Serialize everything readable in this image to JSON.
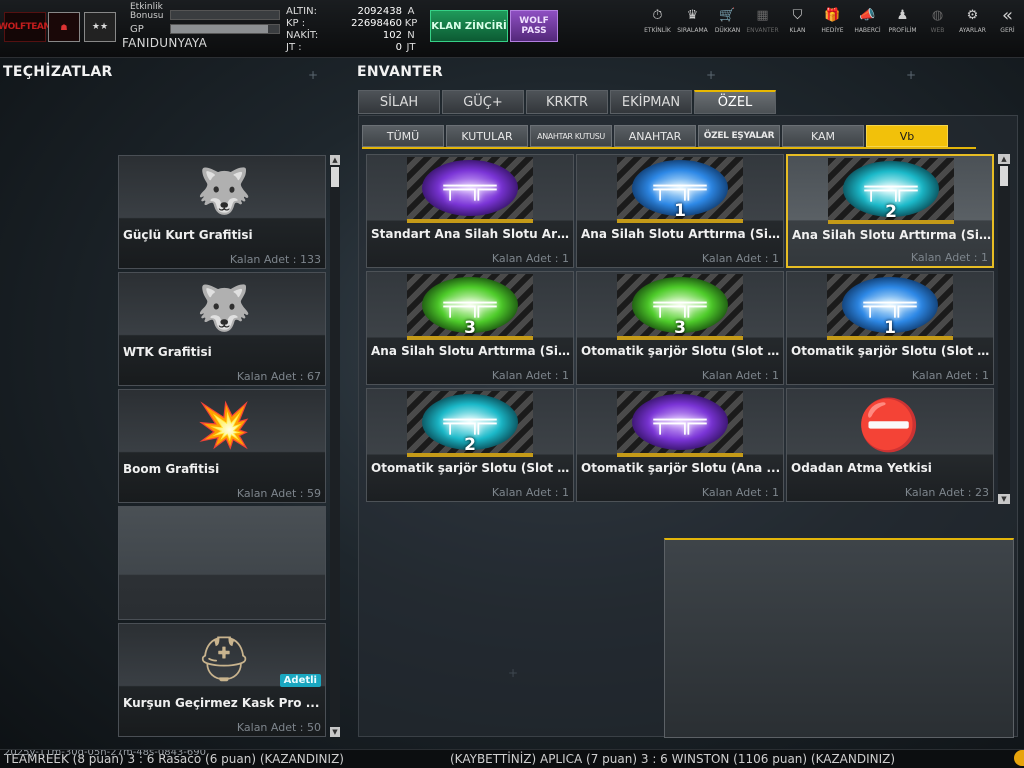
{
  "header": {
    "logo_text": "WOLFTEAM",
    "bonus_label": "Etkinlik Bonusu",
    "gp_label": "GP",
    "bonus_progress": 0,
    "gp_progress": 0.9,
    "username": "FANIDUNYAYA",
    "currencies": [
      {
        "label": "ALTIN:",
        "value": "2092438",
        "unit": "A"
      },
      {
        "label": "KP  :",
        "value": "22698460",
        "unit": "KP"
      },
      {
        "label": "NAKİT:",
        "value": "102",
        "unit": "N"
      },
      {
        "label": "JT  :",
        "value": "0",
        "unit": "JT"
      }
    ],
    "klan_zinciri": "KLAN ZİNCİRİ",
    "wolf_pass": "WOLF PASS"
  },
  "nav": [
    {
      "label": "ETKİNLİK",
      "icon": "stopwatch-icon",
      "glyph": "⏱"
    },
    {
      "label": "SIRALAMA",
      "icon": "wolf-badge-icon",
      "glyph": "♛"
    },
    {
      "label": "DÜKKAN",
      "icon": "cart-icon",
      "glyph": "🛒"
    },
    {
      "label": "ENVANTER",
      "icon": "inventory-icon",
      "glyph": "▦"
    },
    {
      "label": "KLAN",
      "icon": "shield-icon",
      "glyph": "⛉"
    },
    {
      "label": "HEDİYE",
      "icon": "gift-icon",
      "glyph": "🎁"
    },
    {
      "label": "HABERCİ",
      "icon": "megaphone-icon",
      "glyph": "📣"
    },
    {
      "label": "PROFİLİM",
      "icon": "profile-icon",
      "glyph": "♟"
    },
    {
      "label": "WEB",
      "icon": "globe-icon",
      "glyph": "◍"
    },
    {
      "label": "AYARLAR",
      "icon": "gear-icon",
      "glyph": "⚙"
    },
    {
      "label": "GERİ",
      "icon": "back-icon",
      "glyph": "«"
    }
  ],
  "left": {
    "title": "TEÇHİZATLAR",
    "items": [
      {
        "name": "Güçlü Kurt Grafitisi",
        "count": "Kalan Adet : 133",
        "icon": "wolf-graffiti-icon"
      },
      {
        "name": "WTK Grafitisi",
        "count": "Kalan Adet : 67",
        "icon": "wtk-wolf-icon"
      },
      {
        "name": "Boom Grafitisi",
        "count": "Kalan Adet : 59",
        "icon": "boom-graffiti-icon"
      },
      {
        "name": "",
        "count": "",
        "icon": ""
      },
      {
        "name": "Kurşun Geçirmez Kask Pro ...",
        "count": "Kalan Adet : 50",
        "icon": "helmet-icon",
        "badge": "Adetli"
      }
    ]
  },
  "inventory": {
    "title": "ENVANTER",
    "main_tabs": [
      "SİLAH",
      "GÜÇ+",
      "KRKTR",
      "EKİPMAN",
      "ÖZEL"
    ],
    "active_main_tab": 4,
    "sub_tabs": [
      "TÜMÜ",
      "KUTULAR",
      "ANAHTAR KUTUSU",
      "ANAHTAR",
      "ÖZEL EŞYALAR",
      "KAM",
      "Vb"
    ],
    "active_sub_tab": 6,
    "items": [
      {
        "name": "Standart Ana Silah Slotu Artt...",
        "count": "Kalan Adet : 1",
        "color": "purple",
        "slot": ""
      },
      {
        "name": "Ana Silah Slotu Arttırma (Sil...",
        "count": "Kalan Adet : 1",
        "color": "blue",
        "slot": "1"
      },
      {
        "name": "Ana Silah Slotu Arttırma (Si...",
        "count": "Kalan Adet : 1",
        "color": "cyan",
        "slot": "2",
        "selected": true
      },
      {
        "name": "Ana Silah Slotu Arttırma (Sil...",
        "count": "Kalan Adet : 1",
        "color": "green",
        "slot": "3"
      },
      {
        "name": "Otomatik şarjör Slotu (Slot 3)",
        "count": "Kalan Adet : 1",
        "color": "green",
        "slot": "3"
      },
      {
        "name": "Otomatik şarjör Slotu (Slot 1)",
        "count": "Kalan Adet : 1",
        "color": "blue",
        "slot": "1"
      },
      {
        "name": "Otomatik şarjör Slotu (Slot 2)",
        "count": "Kalan Adet : 1",
        "color": "cyan",
        "slot": "2"
      },
      {
        "name": "Otomatik şarjör Slotu (Ana ...",
        "count": "Kalan Adet : 1",
        "color": "purple",
        "slot": ""
      },
      {
        "name": "Odadan Atma Yetkisi",
        "count": "Kalan Adet : 23",
        "color": "ban",
        "slot": ""
      }
    ]
  },
  "ticker": {
    "left": "2025y-11m-30d-05h-27m-48s-0843-690",
    "middle": "TEAMREEK (8 puan) 3 : 6 Rasaco (6 puan) (KAZANDINIZ)",
    "right": "(KAYBETTİNİZ) APLICA (7 puan) 3 : 6 WINSTON (1106 puan) (KAZANDINIZ)"
  },
  "colors": {
    "accent": "#e3b50a",
    "klan_green": "#1f9a5a",
    "wolf_purple": "#8e4fc2",
    "adetli_cyan": "#1aa7c0"
  }
}
